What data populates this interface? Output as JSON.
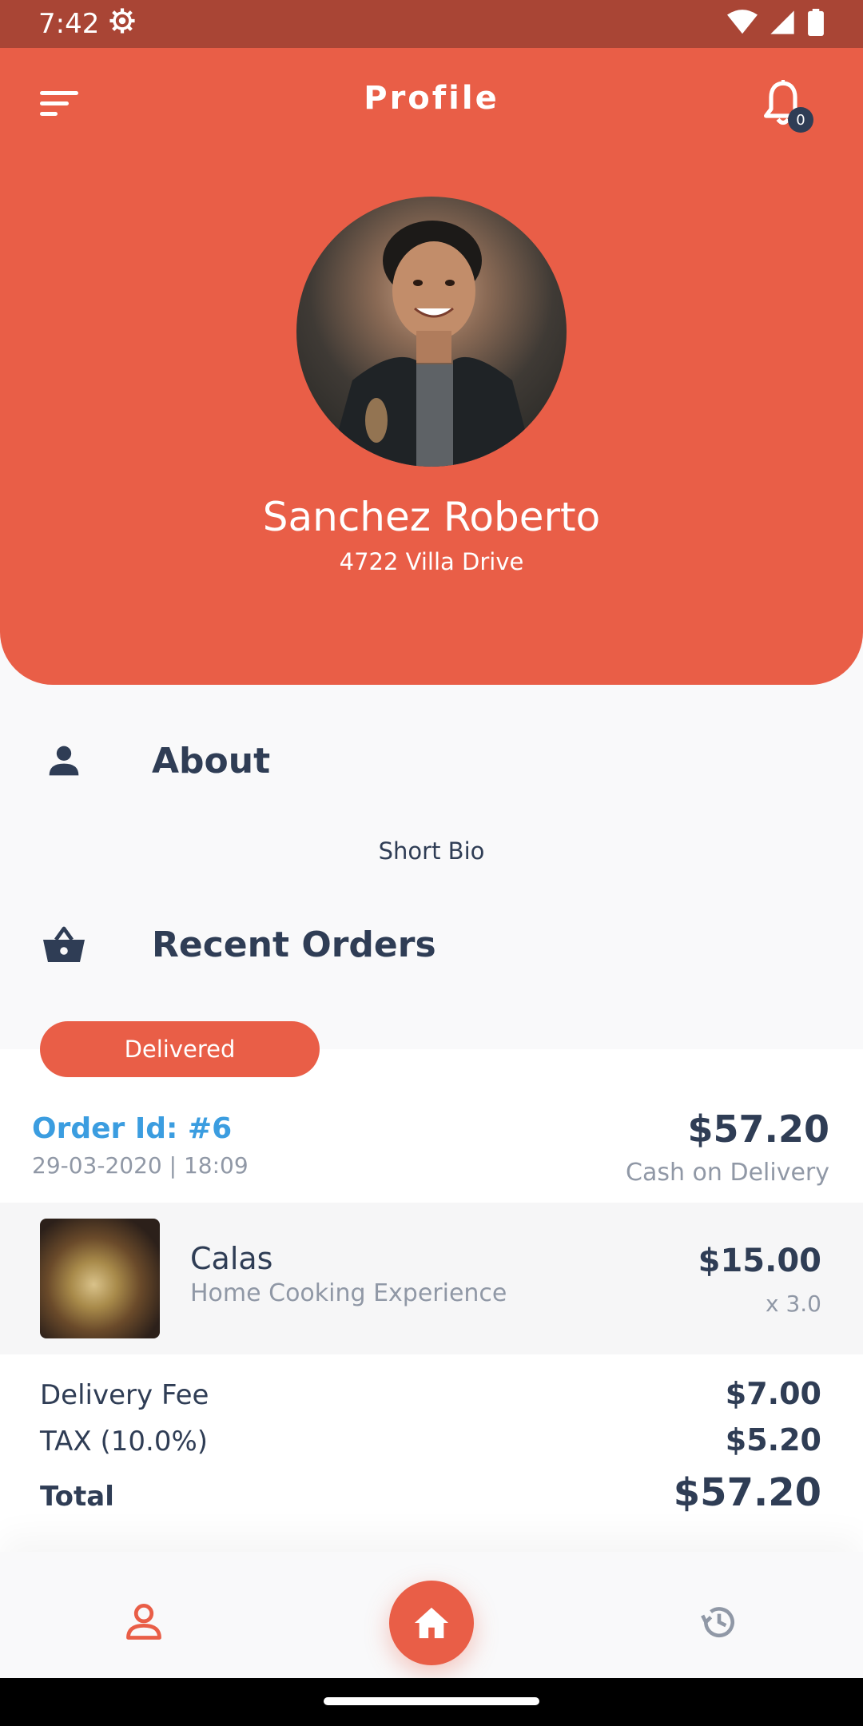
{
  "status_bar": {
    "time": "7:42"
  },
  "app_bar": {
    "title": "Profile",
    "notification_count": "0"
  },
  "profile": {
    "name": "Sanchez Roberto",
    "address": "4722 Villa Drive"
  },
  "about": {
    "title": "About",
    "bio": "Short Bio"
  },
  "recent_orders": {
    "title": "Recent Orders",
    "order": {
      "status": "Delivered",
      "id": "Order Id: #6",
      "date": "29-03-2020 | 18:09",
      "total": "$57.20",
      "payment_method": "Cash on Delivery",
      "items": [
        {
          "name": "Calas",
          "description": "Home Cooking Experience",
          "price": "$15.00",
          "quantity": "x 3.0"
        }
      ],
      "delivery_fee_label": "Delivery Fee",
      "delivery_fee": "$7.00",
      "tax_label": "TAX (10.0%)",
      "tax": "$5.20",
      "total_label": "Total",
      "grand_total": "$57.20"
    }
  },
  "bottom_nav": {
    "items": [
      {
        "icon": "person-icon",
        "active": true
      },
      {
        "icon": "home-icon",
        "active": false
      },
      {
        "icon": "history-icon",
        "active": false
      }
    ]
  },
  "colors": {
    "accent": "#e95e47",
    "dark_text": "#2f3d55",
    "link_blue": "#3b9de0",
    "muted_text": "#9098a6"
  }
}
